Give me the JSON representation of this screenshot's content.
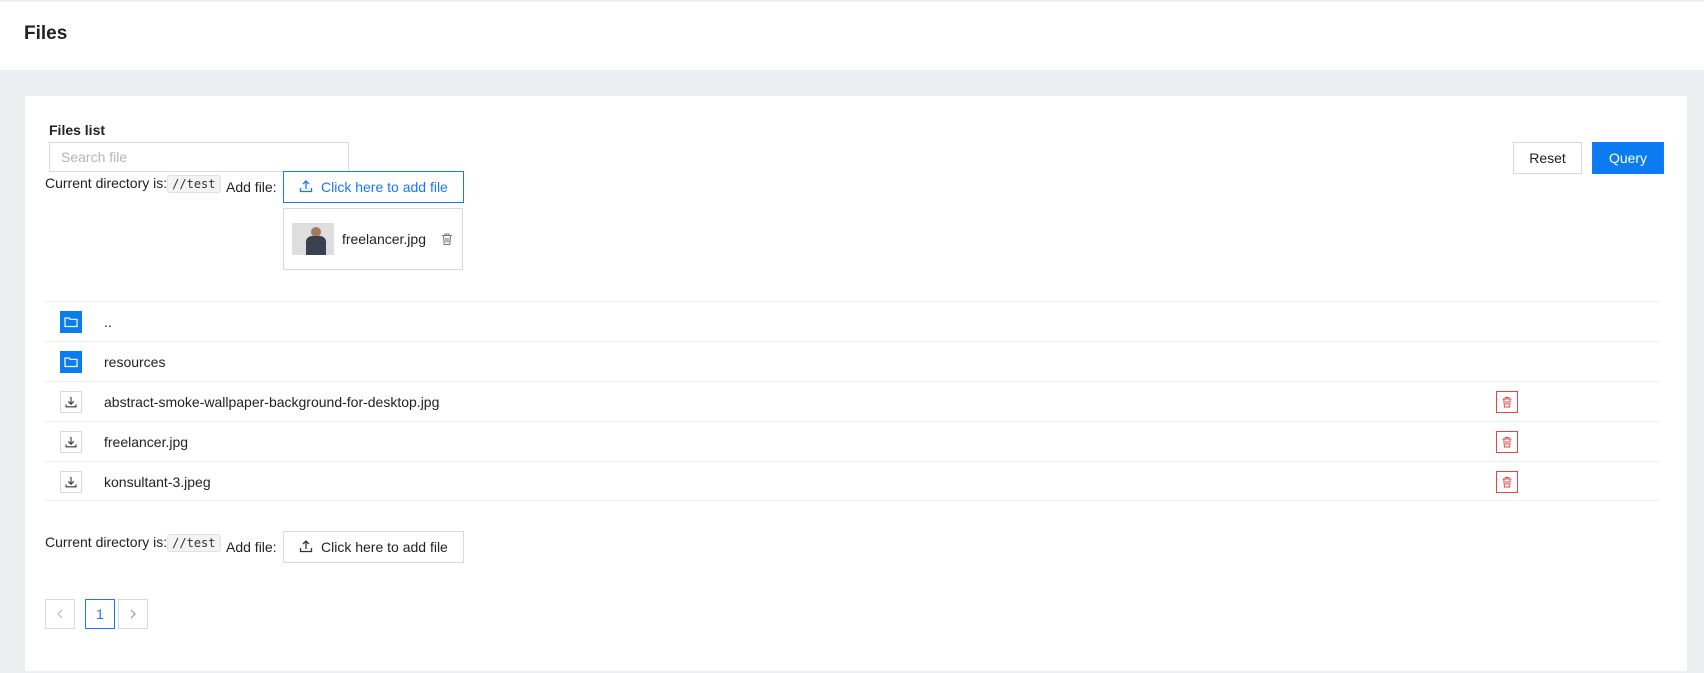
{
  "header": {
    "title": "Files"
  },
  "files_list": {
    "label": "Files list",
    "search": {
      "placeholder": "Search file",
      "value": ""
    },
    "reset_label": "Reset",
    "query_label": "Query",
    "current_dir_label": "Current directory is:",
    "current_dir_value": "//test",
    "add_file_label": "Add file",
    "add_file_colon": ":",
    "upload_button_label": "Click here to add file",
    "pending_upload": {
      "file_name": "freelancer.jpg"
    }
  },
  "entries": [
    {
      "type": "folder",
      "name": ".."
    },
    {
      "type": "folder",
      "name": "resources"
    },
    {
      "type": "file",
      "name": "abstract-smoke-wallpaper-background-for-desktop.jpg"
    },
    {
      "type": "file",
      "name": "freelancer.jpg"
    },
    {
      "type": "file",
      "name": "konsultant-3.jpeg"
    }
  ],
  "pagination": {
    "current_page": "1",
    "prev_icon": "chevron-left-icon",
    "next_icon": "chevron-right-icon"
  },
  "colors": {
    "primary": "#0a7cf0",
    "danger": "#e54545",
    "background": "#eceef1"
  }
}
